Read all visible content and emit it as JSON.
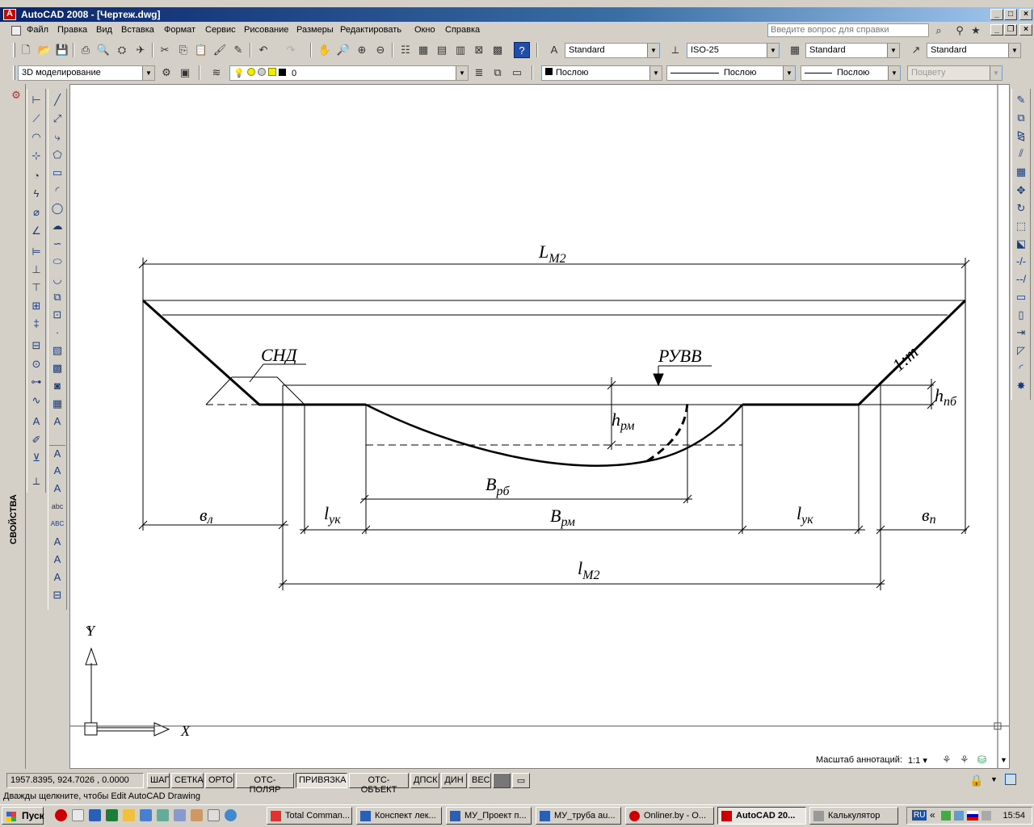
{
  "window": {
    "title": "AutoCAD 2008 - [Чертеж.dwg]",
    "controls": [
      "_",
      "□",
      "×"
    ]
  },
  "menu": {
    "items": [
      "Файл",
      "Правка",
      "Вид",
      "Вставка",
      "Формат",
      "Сервис",
      "Рисование",
      "Размеры",
      "Редактировать",
      "Окно",
      "Справка"
    ],
    "help_placeholder": "Введите вопрос для справки"
  },
  "toolbar_styles": {
    "text_style": "Standard",
    "dim_style": "ISO-25",
    "table_style": "Standard",
    "multileader_style": "Standard"
  },
  "toolbar_layers": {
    "workspace": "3D моделирование",
    "layer": "0",
    "color": "Послою",
    "linetype": "Послою",
    "lineweight": "Послою",
    "plotstyle": "Поцвету"
  },
  "side_panel": {
    "properties_label": "СВОЙСТВА"
  },
  "drawing": {
    "labels": {
      "L": "L",
      "L_sub": "M2",
      "snd": "СНД",
      "ruvv": "РУВВ",
      "slope": "1:m",
      "h_pb": "h",
      "h_pb_sub": "пб",
      "h_rm": "h",
      "h_rm_sub": "рм",
      "b_rb": "B",
      "b_rb_sub": "рб",
      "b_rm": "B",
      "b_rm_sub": "рм",
      "l_uk_left": "l",
      "l_uk_left_sub": "ук",
      "l_uk_right": "l",
      "l_uk_right_sub": "ук",
      "e_left": "в",
      "e_left_sub": "л",
      "e_right": "в",
      "e_right_sub": "п",
      "l_m2": "l",
      "l_m2_sub": "M2"
    },
    "ucs": {
      "x": "X",
      "y": "Y"
    }
  },
  "annotation": {
    "label": "Масштаб аннотаций:",
    "value": "1:1"
  },
  "status": {
    "coords": "1957.8395, 924.7026 , 0.0000",
    "modes": [
      "ШАГ",
      "СЕТКА",
      "ОРТО",
      "ОТС-ПОЛЯР",
      "ПРИВЯЗКА",
      "ОТС-ОБЪЕКТ",
      "ДПСК",
      "ДИН",
      "ВЕС"
    ],
    "hint": "Дважды щелкните, чтобы Edit AutoCAD Drawing"
  },
  "taskbar": {
    "start": "Пуск",
    "tasks": [
      "Total Comman...",
      "Конспект лек...",
      "МУ_Проект п...",
      "МУ_труба au...",
      "Onliner.by - O...",
      "AutoCAD 20...",
      "Калькулятор"
    ],
    "lang": "RU",
    "clock": "15:54"
  }
}
